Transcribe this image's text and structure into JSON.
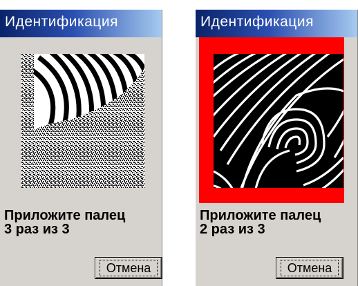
{
  "dialogs": [
    {
      "title": "Идентификация",
      "prompt_line1": "Приложите палец",
      "prompt_line2": "3 раз из 3",
      "cancel_label": "Отмена",
      "frame_alert": false
    },
    {
      "title": "Идентификация",
      "prompt_line1": "Приложите палец",
      "prompt_line2": "2 раз из 3",
      "cancel_label": "Отмена",
      "frame_alert": true,
      "frame_color": "#ff0000"
    }
  ],
  "colors": {
    "titlebar_start": "#0a246a",
    "titlebar_end": "#a6caf0",
    "dialog_bg": "#d6d3ce"
  }
}
